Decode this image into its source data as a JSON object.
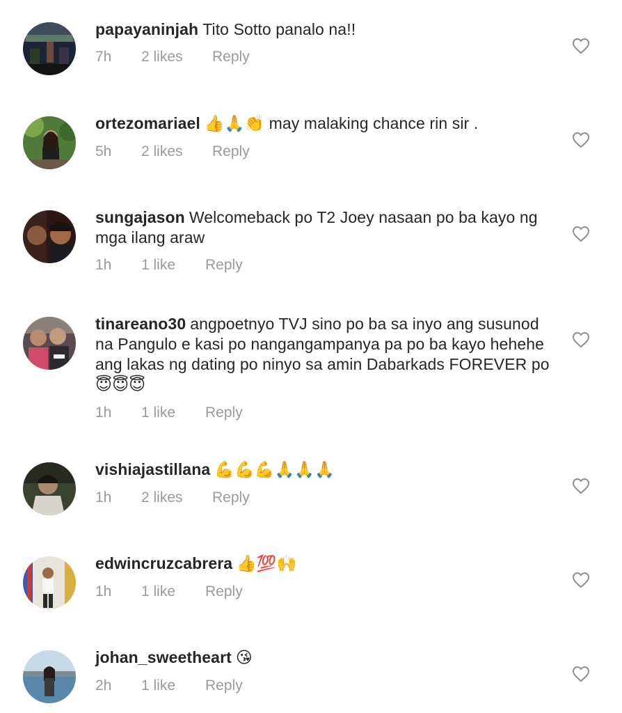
{
  "comments": [
    {
      "username": "papayaninjah",
      "text": "Tito Sotto panalo na!!",
      "time": "7h",
      "likes": "2 likes",
      "reply": "Reply",
      "icons": [
        "heart-outline-icon"
      ]
    },
    {
      "username": "ortezomariael",
      "emojis": "👍🙏👏",
      "text": " may  malaking  chance rin sir .",
      "time": "5h",
      "likes": "2 likes",
      "reply": "Reply"
    },
    {
      "username": "sungajason",
      "text": "Welcomeback po T2 Joey nasaan po ba kayo ng mga ilang araw",
      "time": "1h",
      "likes": "1 like",
      "reply": "Reply"
    },
    {
      "username": "tinareano30",
      "text": "angpoetnyo TVJ sino po ba sa inyo ang susunod na Pangulo e kasi po nangangampanya pa po ba kayo hehehe ang lakas ng dating po ninyo sa amin Dabarkads FOREVER po",
      "emojis_after": "😇😇😇",
      "time": "1h",
      "likes": "1 like",
      "reply": "Reply"
    },
    {
      "username": "vishiajastillana",
      "emojis": "💪💪💪🙏🙏🙏",
      "time": "1h",
      "likes": "2 likes",
      "reply": "Reply"
    },
    {
      "username": "edwincruzcabrera",
      "emojis": "👍💯🙌",
      "time": "1h",
      "likes": "1 like",
      "reply": "Reply"
    },
    {
      "username": "johan_sweetheart",
      "emojis": "😘",
      "time": "2h",
      "likes": "1 like",
      "reply": "Reply"
    }
  ],
  "colors": {
    "text": "#262626",
    "meta": "#9a9a9a",
    "heart": "#8e8e8e"
  }
}
